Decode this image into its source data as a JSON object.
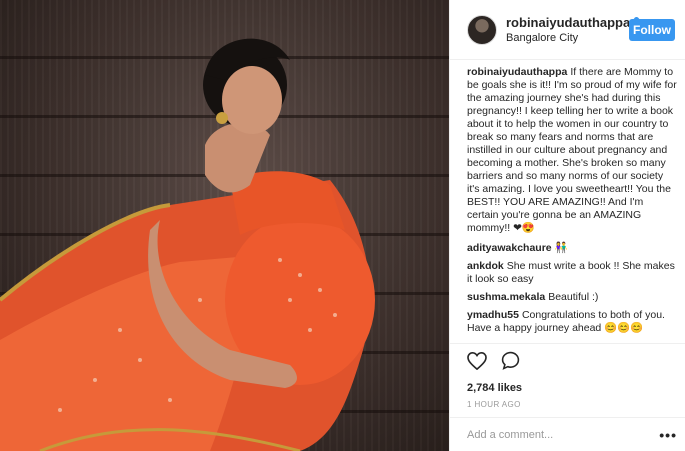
{
  "post": {
    "username": "robinaiyudauthappa",
    "verified": true,
    "location": "Bangalore City",
    "follow_label": "Follow",
    "likes": "2,784 likes",
    "time": "1 HOUR AGO",
    "add_comment_placeholder": "Add a comment...",
    "more_label": "•••"
  },
  "caption": {
    "user": "robinaiyudauthappa",
    "text": "If there are Mommy to be goals she is it!! I'm so proud of my wife for the amazing journey she's had during this pregnancy!! I keep telling her to write a book about it to help the women in our country to break so many fears and norms that are instilled in our culture about pregnancy and becoming a mother. She's broken so many barriers and so many norms of our society it's amazing. I love you sweetheart!! You the BEST!! YOU ARE AMAZING!! And I'm certain you're gonna be an AMAZING mommy!! ❤😍"
  },
  "comments": [
    {
      "user": "adityawakchaure",
      "text": "👫"
    },
    {
      "user": "ankdok",
      "text": "She must write a book !! She makes it look so easy"
    },
    {
      "user": "sushma.mekala",
      "text": "Beautiful :)"
    },
    {
      "user": "ymadhu55",
      "text": "Congratulations to both of you. Have a happy journey ahead 😊😊😊"
    }
  ],
  "icons": {
    "like": "heart-icon",
    "comment": "comment-bubble-icon",
    "more": "more-options-icon"
  },
  "colors": {
    "accent": "#3897f0",
    "saree": "#ee5a2e",
    "background_wood": "#3e312d"
  }
}
